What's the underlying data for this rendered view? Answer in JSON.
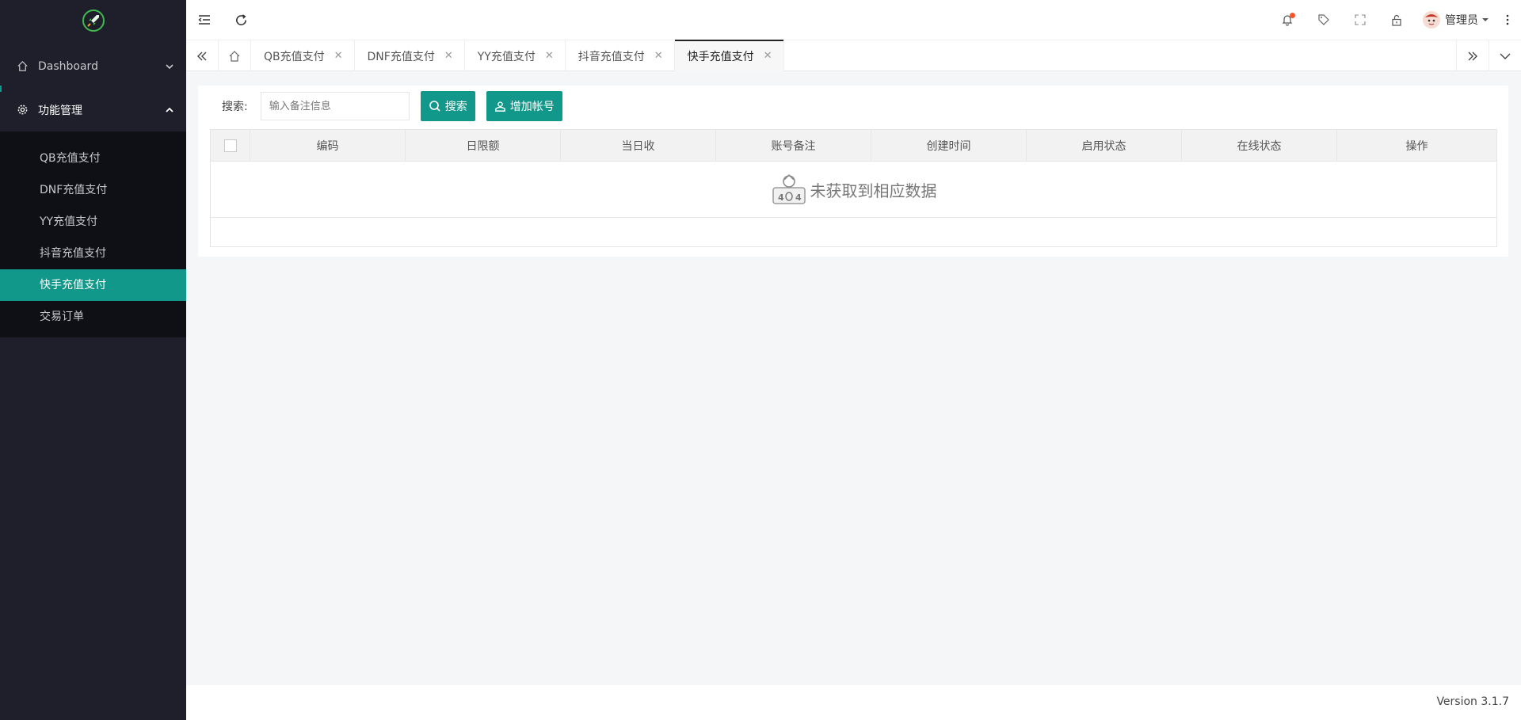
{
  "sidebar": {
    "items": [
      {
        "label": "Dashboard",
        "icon": "home-icon",
        "expanded": false
      },
      {
        "label": "功能管理",
        "icon": "gear-icon",
        "expanded": true
      }
    ],
    "subitems": [
      {
        "label": "QB充值支付"
      },
      {
        "label": "DNF充值支付"
      },
      {
        "label": "YY充值支付"
      },
      {
        "label": "抖音充值支付"
      },
      {
        "label": "快手充值支付",
        "active": true
      },
      {
        "label": "交易订单"
      }
    ]
  },
  "header": {
    "user_name": "管理员"
  },
  "tabs": [
    {
      "label": "QB充值支付"
    },
    {
      "label": "DNF充值支付"
    },
    {
      "label": "YY充值支付"
    },
    {
      "label": "抖音充值支付"
    },
    {
      "label": "快手充值支付",
      "active": true
    }
  ],
  "toolbar": {
    "search_label": "搜索:",
    "search_placeholder": "输入备注信息",
    "search_value": "",
    "search_button": "搜索",
    "add_button": "增加帐号"
  },
  "table": {
    "columns": [
      "编码",
      "日限额",
      "当日收",
      "账号备注",
      "创建时间",
      "启用状态",
      "在线状态",
      "操作"
    ],
    "empty_text": "未获取到相应数据"
  },
  "footer": {
    "version": "Version 3.1.7"
  },
  "colors": {
    "accent": "#11988a",
    "sidebar_bg": "#1e1f2a",
    "badge_dot": "#f2572b"
  }
}
